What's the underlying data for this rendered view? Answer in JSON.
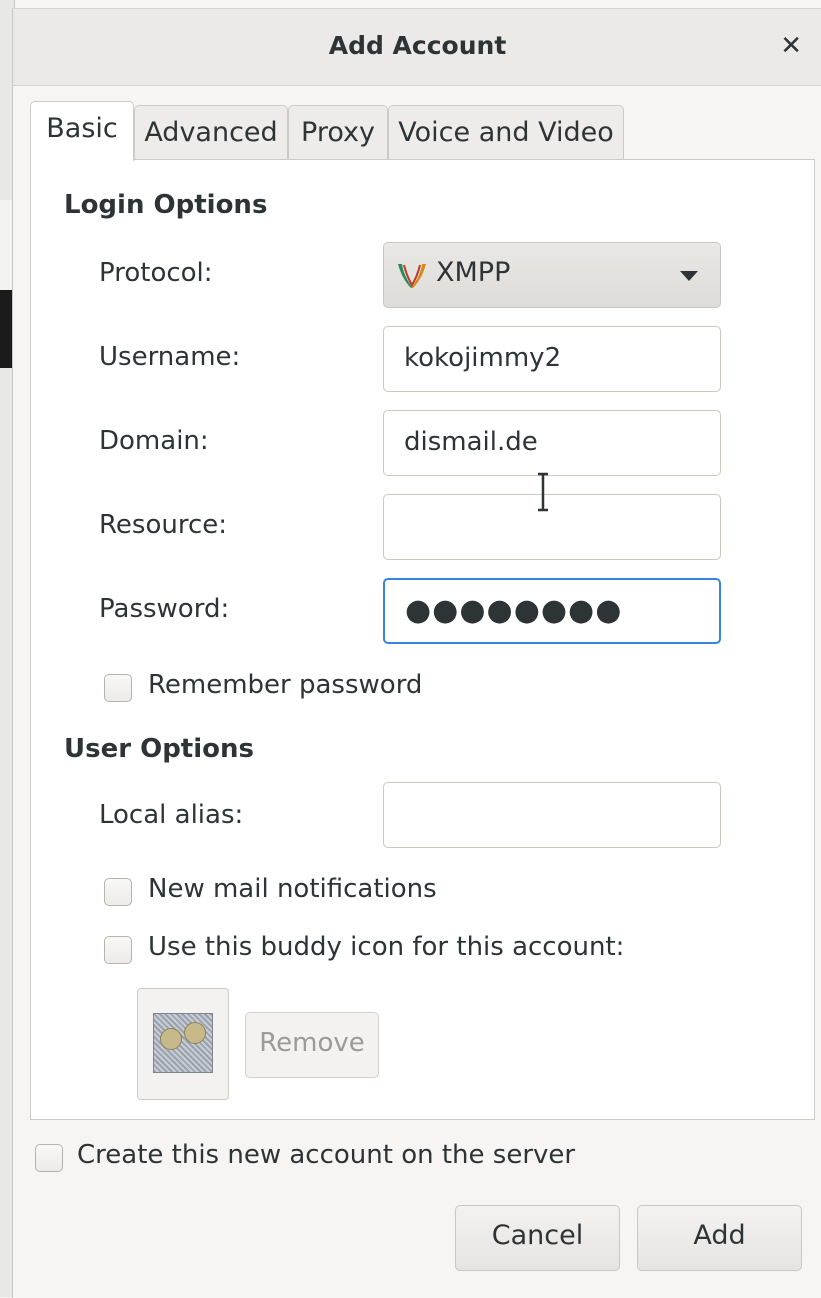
{
  "dialog": {
    "title": "Add Account"
  },
  "tabs": [
    {
      "label": "Basic",
      "active": true
    },
    {
      "label": "Advanced",
      "active": false
    },
    {
      "label": "Proxy",
      "active": false
    },
    {
      "label": "Voice and Video",
      "active": false
    }
  ],
  "login_options": {
    "heading": "Login Options",
    "protocol_label": "Protocol:",
    "protocol_value": "XMPP",
    "username_label": "Username:",
    "username_value": "kokojimmy2",
    "domain_label": "Domain:",
    "domain_value": "dismail.de",
    "resource_label": "Resource:",
    "resource_value": "",
    "password_label": "Password:",
    "password_value": "●●●●●●●●",
    "remember_password_label": "Remember password",
    "remember_password_checked": false
  },
  "user_options": {
    "heading": "User Options",
    "local_alias_label": "Local alias:",
    "local_alias_value": "",
    "new_mail_label": "New mail notifications",
    "new_mail_checked": false,
    "buddy_icon_label": "Use this buddy icon for this account:",
    "buddy_icon_checked": false,
    "remove_label": "Remove"
  },
  "create_on_server_label": "Create this new account on the server",
  "create_on_server_checked": false,
  "buttons": {
    "cancel": "Cancel",
    "add": "Add"
  },
  "icons": {
    "close": "close-icon",
    "protocol": "xmpp-icon",
    "dropdown": "chevron-down-icon",
    "buddy": "buddy-image-icon",
    "cursor": "text-cursor-icon"
  },
  "colors": {
    "focus_border": "#3584e4",
    "panel_bg": "#ffffff",
    "window_bg": "#f6f5f4"
  }
}
